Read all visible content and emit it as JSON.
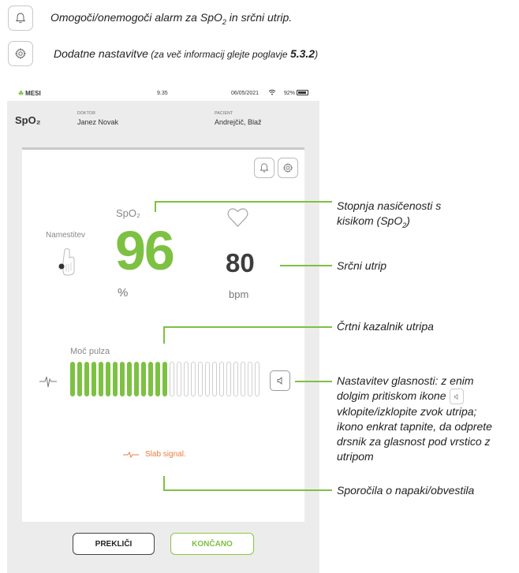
{
  "legend": {
    "alarm": {
      "icon": "bell-icon",
      "text_before": "Omogoči/onemogoči alarm za SpO",
      "sub": "2",
      "text_after": " in srčni utrip."
    },
    "settings": {
      "icon": "gear-icon",
      "text": "Dodatne nastavitve",
      "note_before": " (za več informacij glejte poglavje ",
      "note_ref": "5.3.2",
      "note_after": ")"
    }
  },
  "device": {
    "status_bar": {
      "brand": "MESI",
      "time": "9.35",
      "date": "06/05/2021",
      "battery": "92%"
    },
    "header": {
      "title": "SpO₂",
      "doctor_label": "DOKTOR",
      "doctor_name": "Janez Novak",
      "patient_label": "PACIENT",
      "patient_name": "Andrejčič, Blaž"
    },
    "measurement": {
      "spo2_label": "SpO₂",
      "spo2_value": "96",
      "spo2_unit": "%",
      "heart_rate_value": "80",
      "heart_rate_unit": "bpm",
      "placement_label": "Namestitev"
    },
    "pulse": {
      "label": "Moč pulza",
      "active_bars": 14,
      "total_bars": 27,
      "colors": {
        "active": "#7dc142",
        "inactive_border": "#cfcfcf"
      }
    },
    "signal_message": "Slab signal.",
    "buttons": {
      "cancel": "PREKLIČI",
      "done": "KONČANO"
    }
  },
  "callouts": {
    "spo2": {
      "line1": "Stopnja nasičenosti s",
      "line2_before": "kisikom (SpO",
      "line2_sub": "2",
      "line2_after": ")"
    },
    "heart_rate": "Srčni utrip",
    "pulse_bar": "Črtni kazalnik utripa",
    "volume": {
      "line1": "Nastavitev glasnosti: z enim",
      "line2": "dolgim pritiskom ikone",
      "line3": "vklopite/izklopite zvok utripa;",
      "line4": "ikono enkrat tapnite, da odprete",
      "line5": "drsnik za glasnost pod vrstico z",
      "line6": "utripom"
    },
    "errors": "Sporočila o napaki/obvestila"
  },
  "colors": {
    "accent": "#7dc142",
    "warning": "#f07b3a"
  }
}
